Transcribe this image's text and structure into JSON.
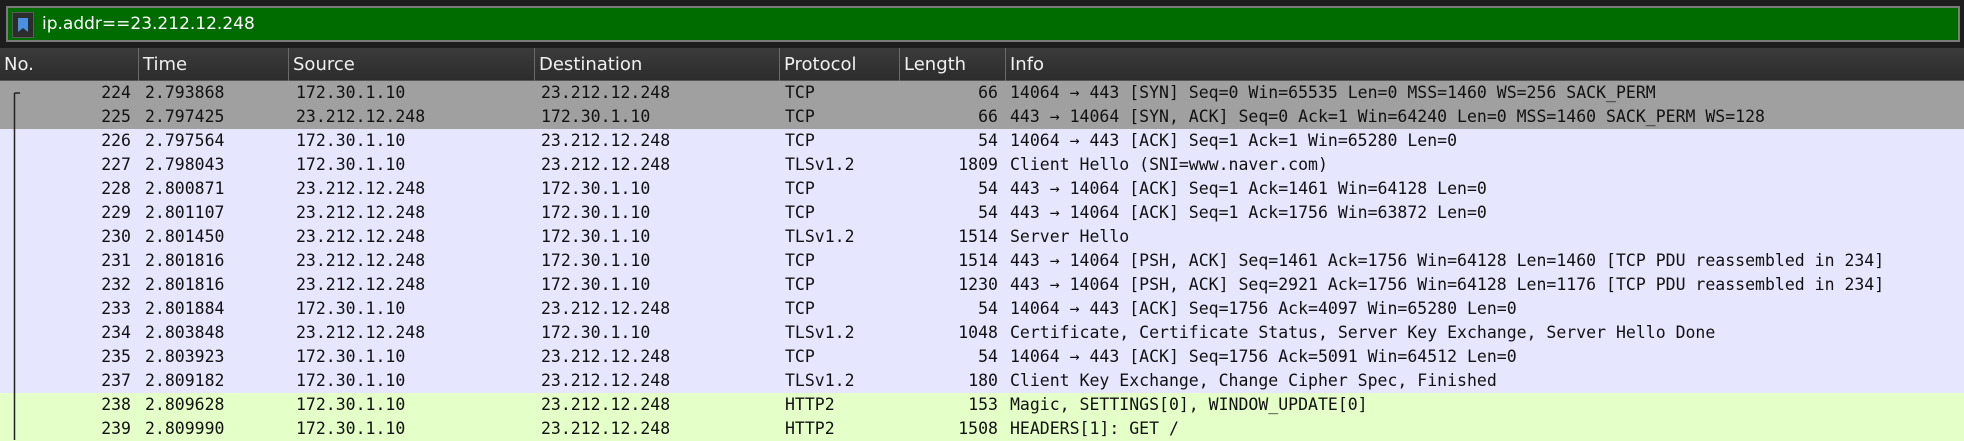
{
  "filter": {
    "value": "ip.addr==23.212.12.248",
    "bookmark_icon": "bookmark-icon"
  },
  "columns": [
    "No.",
    "Time",
    "Source",
    "Destination",
    "Protocol",
    "Length",
    "Info"
  ],
  "colors": {
    "selected_bg": "#a0a0a0",
    "tcp_bg": "#e7e6ff",
    "http2_bg": "#e4ffc7",
    "filter_bg": "#006c00"
  },
  "packets": [
    {
      "no": "224",
      "time": "2.793868",
      "src": "172.30.1.10",
      "dst": "23.212.12.248",
      "proto": "TCP",
      "len": "66",
      "info": "14064 → 443 [SYN] Seq=0 Win=65535 Len=0 MSS=1460 WS=256 SACK_PERM",
      "style": "selected"
    },
    {
      "no": "225",
      "time": "2.797425",
      "src": "23.212.12.248",
      "dst": "172.30.1.10",
      "proto": "TCP",
      "len": "66",
      "info": "443 → 14064 [SYN, ACK] Seq=0 Ack=1 Win=64240 Len=0 MSS=1460 SACK_PERM WS=128",
      "style": "selected"
    },
    {
      "no": "226",
      "time": "2.797564",
      "src": "172.30.1.10",
      "dst": "23.212.12.248",
      "proto": "TCP",
      "len": "54",
      "info": "14064 → 443 [ACK] Seq=1 Ack=1 Win=65280 Len=0",
      "style": "tcp"
    },
    {
      "no": "227",
      "time": "2.798043",
      "src": "172.30.1.10",
      "dst": "23.212.12.248",
      "proto": "TLSv1.2",
      "len": "1809",
      "info": "Client Hello (SNI=www.naver.com)",
      "style": "tcp"
    },
    {
      "no": "228",
      "time": "2.800871",
      "src": "23.212.12.248",
      "dst": "172.30.1.10",
      "proto": "TCP",
      "len": "54",
      "info": "443 → 14064 [ACK] Seq=1 Ack=1461 Win=64128 Len=0",
      "style": "tcp"
    },
    {
      "no": "229",
      "time": "2.801107",
      "src": "23.212.12.248",
      "dst": "172.30.1.10",
      "proto": "TCP",
      "len": "54",
      "info": "443 → 14064 [ACK] Seq=1 Ack=1756 Win=63872 Len=0",
      "style": "tcp"
    },
    {
      "no": "230",
      "time": "2.801450",
      "src": "23.212.12.248",
      "dst": "172.30.1.10",
      "proto": "TLSv1.2",
      "len": "1514",
      "info": "Server Hello",
      "style": "tcp"
    },
    {
      "no": "231",
      "time": "2.801816",
      "src": "23.212.12.248",
      "dst": "172.30.1.10",
      "proto": "TCP",
      "len": "1514",
      "info": "443 → 14064 [PSH, ACK] Seq=1461 Ack=1756 Win=64128 Len=1460 [TCP PDU reassembled in 234]",
      "style": "tcp"
    },
    {
      "no": "232",
      "time": "2.801816",
      "src": "23.212.12.248",
      "dst": "172.30.1.10",
      "proto": "TCP",
      "len": "1230",
      "info": "443 → 14064 [PSH, ACK] Seq=2921 Ack=1756 Win=64128 Len=1176 [TCP PDU reassembled in 234]",
      "style": "tcp"
    },
    {
      "no": "233",
      "time": "2.801884",
      "src": "172.30.1.10",
      "dst": "23.212.12.248",
      "proto": "TCP",
      "len": "54",
      "info": "14064 → 443 [ACK] Seq=1756 Ack=4097 Win=65280 Len=0",
      "style": "tcp"
    },
    {
      "no": "234",
      "time": "2.803848",
      "src": "23.212.12.248",
      "dst": "172.30.1.10",
      "proto": "TLSv1.2",
      "len": "1048",
      "info": "Certificate, Certificate Status, Server Key Exchange, Server Hello Done",
      "style": "tcp"
    },
    {
      "no": "235",
      "time": "2.803923",
      "src": "172.30.1.10",
      "dst": "23.212.12.248",
      "proto": "TCP",
      "len": "54",
      "info": "14064 → 443 [ACK] Seq=1756 Ack=5091 Win=64512 Len=0",
      "style": "tcp"
    },
    {
      "no": "237",
      "time": "2.809182",
      "src": "172.30.1.10",
      "dst": "23.212.12.248",
      "proto": "TLSv1.2",
      "len": "180",
      "info": "Client Key Exchange, Change Cipher Spec, Finished",
      "style": "tcp"
    },
    {
      "no": "238",
      "time": "2.809628",
      "src": "172.30.1.10",
      "dst": "23.212.12.248",
      "proto": "HTTP2",
      "len": "153",
      "info": "Magic, SETTINGS[0], WINDOW_UPDATE[0]",
      "style": "http2"
    },
    {
      "no": "239",
      "time": "2.809990",
      "src": "172.30.1.10",
      "dst": "23.212.12.248",
      "proto": "HTTP2",
      "len": "1508",
      "info": "HEADERS[1]: GET /",
      "style": "http2"
    }
  ]
}
